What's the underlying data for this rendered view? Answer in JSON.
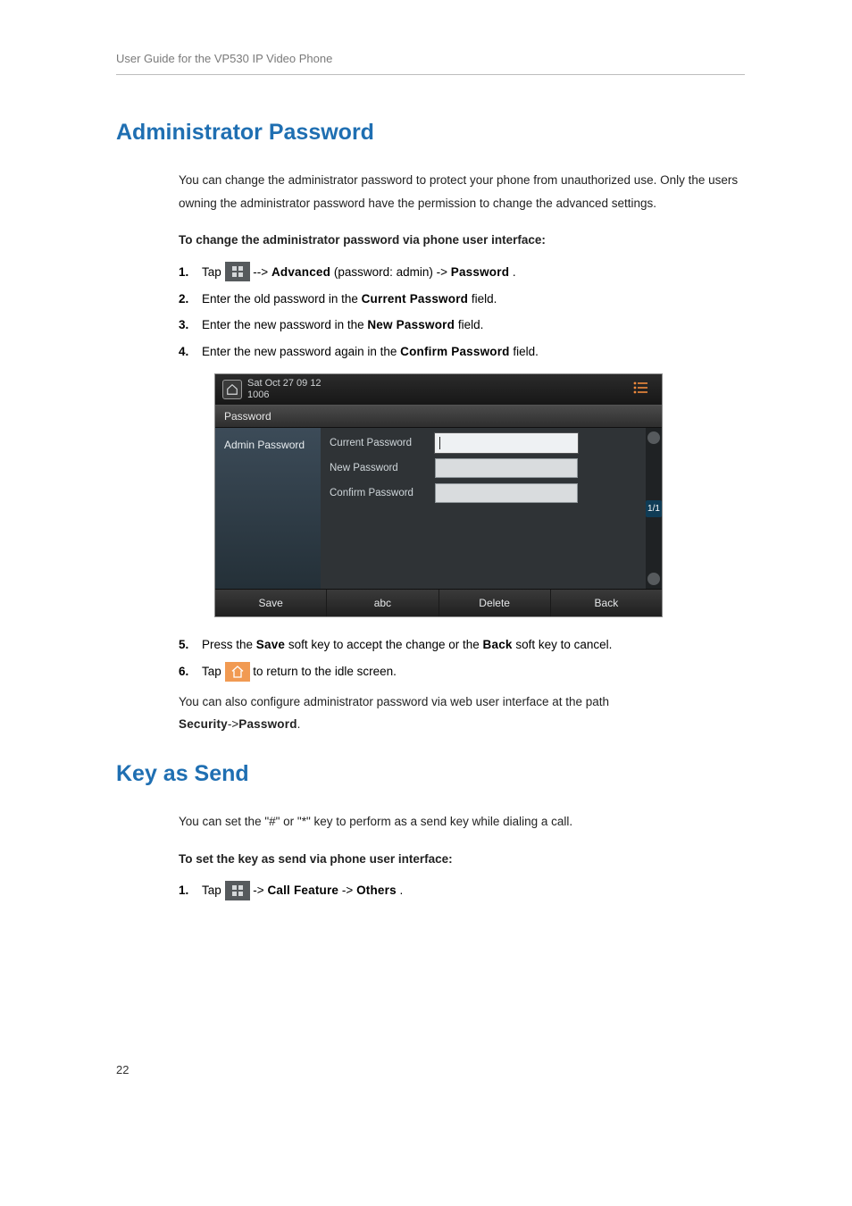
{
  "header": {
    "running": "User Guide for the VP530 IP Video Phone"
  },
  "sectionA": {
    "title": "Administrator Password",
    "intro": "You can change the administrator password to protect your phone from unauthorized use. Only the users owning the administrator password have the permission to change the advanced settings.",
    "instruction": "To change the administrator password via phone user interface:",
    "step1a": "Tap ",
    "step1b": " --> ",
    "step1_advanced": "Advanced",
    "step1_paren": " (password: admin) ->",
    "step1_password": "Password",
    "step1_end": ".",
    "step2a": "Enter the old password in the ",
    "step2b": "Current Password",
    "step2c": " field.",
    "step3a": "Enter the new password in the ",
    "step3b": "New Password",
    "step3c": " field.",
    "step4a": "Enter the new password again in the ",
    "step4b": "Confirm Password",
    "step4c": " field.",
    "step5a": "Press the ",
    "step5b": "Save",
    "step5c": " soft key to accept the change or the ",
    "step5d": "Back",
    "step5e": " soft key to cancel.",
    "step6a": "Tap ",
    "step6b": " to return to the idle screen.",
    "after1": "You can also configure administrator password via web user interface at the path ",
    "after2": "Security",
    "after3": "->",
    "after4": "Password",
    "after5": "."
  },
  "screenshot": {
    "date": "Sat Oct 27 09 12",
    "ext": "1006",
    "title": "Password",
    "left_item": "Admin Password",
    "row1": "Current Password",
    "row2": "New Password",
    "row3": "Confirm Password",
    "page": "1/1",
    "sk1": "Save",
    "sk2": "abc",
    "sk3": "Delete",
    "sk4": "Back"
  },
  "sectionB": {
    "title": "Key as Send",
    "intro": "You can set the \"#\" or \"*\" key to perform as a send key while dialing a call.",
    "instruction": "To set the key as send via phone user interface:",
    "step1a": "Tap ",
    "step1b": " ->",
    "step1c": "Call Feature",
    "step1d": "->",
    "step1e": "Others",
    "step1f": "."
  },
  "nums": {
    "n1": "1.",
    "n2": "2.",
    "n3": "3.",
    "n4": "4.",
    "n5": "5.",
    "n6": "6."
  },
  "page_number": "22"
}
